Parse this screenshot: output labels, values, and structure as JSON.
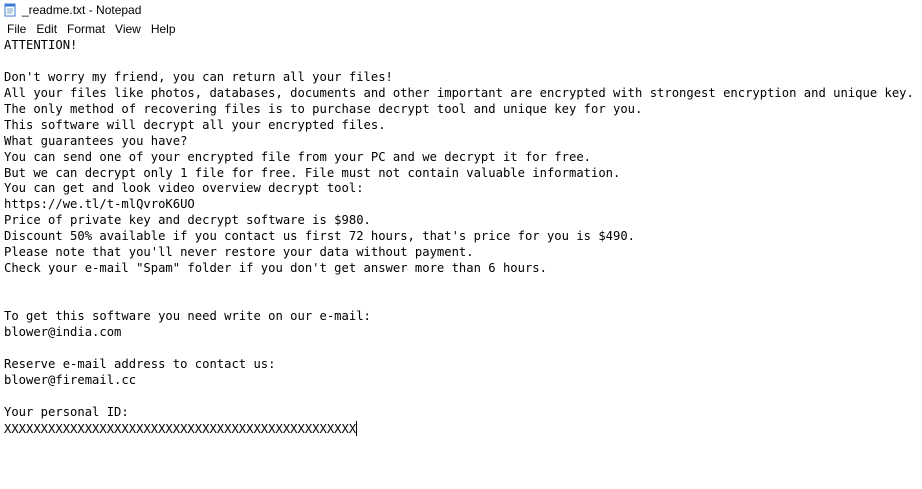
{
  "window": {
    "title": "_readme.txt - Notepad",
    "icon": "notepad-icon"
  },
  "menu": [
    "File",
    "Edit",
    "Format",
    "View",
    "Help"
  ],
  "document": {
    "lines": [
      "ATTENTION!",
      "",
      "Don't worry my friend, you can return all your files!",
      "All your files like photos, databases, documents and other important are encrypted with strongest encryption and unique key.",
      "The only method of recovering files is to purchase decrypt tool and unique key for you.",
      "This software will decrypt all your encrypted files.",
      "What guarantees you have?",
      "You can send one of your encrypted file from your PC and we decrypt it for free.",
      "But we can decrypt only 1 file for free. File must not contain valuable information.",
      "You can get and look video overview decrypt tool:",
      "https://we.tl/t-mlQvroK6UO",
      "Price of private key and decrypt software is $980.",
      "Discount 50% available if you contact us first 72 hours, that's price for you is $490.",
      "Please note that you'll never restore your data without payment.",
      "Check your e-mail \"Spam\" folder if you don't get answer more than 6 hours.",
      "",
      "",
      "To get this software you need write on our e-mail:",
      "blower@india.com",
      "",
      "Reserve e-mail address to contact us:",
      "blower@firemail.cc",
      "",
      "Your personal ID:",
      "XXXXXXXXXXXXXXXXXXXXXXXXXXXXXXXXXXXXXXXXXXXXXXXX"
    ]
  }
}
